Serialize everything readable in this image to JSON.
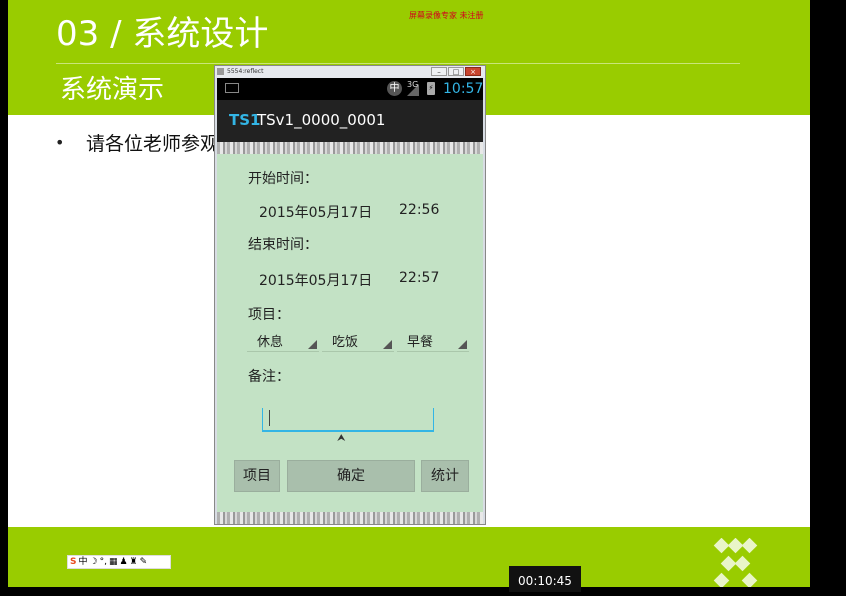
{
  "slide": {
    "title": "03 / 系统设计",
    "subtitle": "系统演示",
    "watermark": "屏幕录像专家  未注册",
    "bullet": "请各位老师参观",
    "timer": "00:10:45",
    "toolbar_icons": [
      "sogou-icon",
      "中",
      "moon-icon",
      "punct-icon",
      "keyboard-icon",
      "user-icon",
      "shirt-icon",
      "wrench-icon"
    ]
  },
  "emulator": {
    "window_title": "5554:reflect",
    "status": {
      "ime": "中",
      "network": "3G",
      "clock": "10:57"
    },
    "actionbar": {
      "brand": "TS1",
      "title": "TSv1_0000_0001"
    },
    "start": {
      "label": "开始时间：",
      "date": "2015年05月17日",
      "time": "22:56"
    },
    "end": {
      "label": "结束时间：",
      "date": "2015年05月17日",
      "time": "22:57"
    },
    "project": {
      "label": "项目：",
      "spinners": [
        "休息",
        "吃饭",
        "早餐"
      ]
    },
    "memo": {
      "label": "备注：",
      "value": ""
    },
    "buttons": {
      "project": "项目",
      "confirm": "确定",
      "stats": "统计"
    }
  },
  "colors": {
    "slide_green": "#99cc00",
    "screen_bg": "#c3e2c5",
    "accent_blue": "#33b5e5"
  }
}
